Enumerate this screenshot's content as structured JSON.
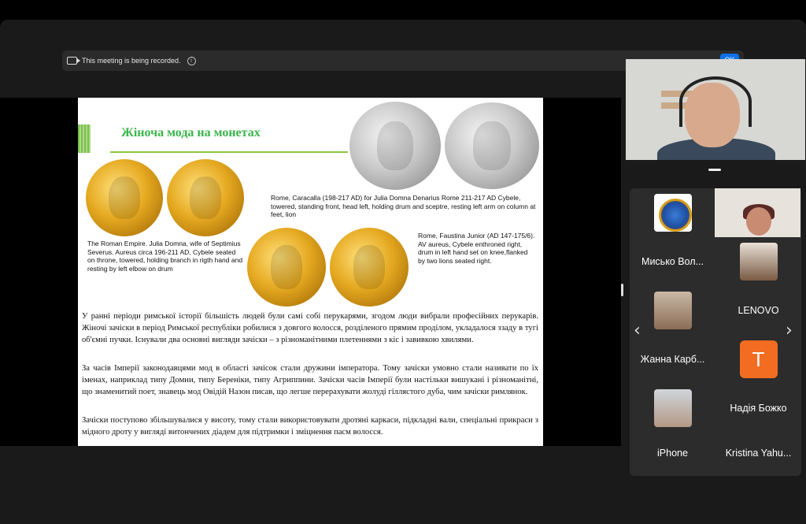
{
  "banner": {
    "text": "This meeting is being recorded.",
    "info": "i",
    "ok_label": "OK"
  },
  "slide": {
    "title": "Жіноча мода на монетах",
    "caption_top_right": "Rome, Caracalla (198-217 AD) for Julia Domna Denarius Rome 211-217 AD Cybele, towered, standing front, head left, holding drum and sceptre, resting left arm on column at feet, lion",
    "caption_left": "The Roman Empire. Julia Domna, wife of Septimius Severus. Aureus circa 196-211 AD, Cybele seated on throne, towered, holding branch in rigth hand and resting by left elbow on drum",
    "caption_right": "Rome, Faustina Junior (AD 147-175/6). AV aureus, Cybele enthroned right, drum in left hand set on knee,flanked by two lions seated right.",
    "paragraphs": [
      "У ранні періоди римської історії більшість людей були самі собі перукарями, згодом люди вибрали професійних перукарів. Жіночі зачіски в період Римської республіки робилися з довгого волосся, розділеного прямим проділом, укладалося ззаду в тугі об'ємні пучки. Існували два основні вигляди зачіски – з різноманітними плетеннями з кіс і завивкою хвилями.",
      "За часів Імперії законодавцями мод в області зачісок стали дружини імператора. Тому зачіски умовно стали називати по їх іменах, наприклад типу Домни, типу Береніки, типу Агриппини. Зачіски часів Імперії були настільки вишукані і різноманітні, що знаменитий поет, знавець мод Овідій Назон писав, що легше перерахувати жолуді гіллястого дуба, чим зачіски римлянок.",
      "Зачіски поступово збільшувалися у висоту, тому стали використовувати дротяні каркаси, підкладні вали, спеціальні прикраси з мідного дроту у вигляді витончених діадем для підтримки і зміцнення пасм волосся."
    ]
  },
  "participants": [
    {
      "name": "Мисько Вол..."
    },
    {
      "name": "LENOVO"
    },
    {
      "name": "Жанна Карб..."
    },
    {
      "name": "Надія Божко",
      "initial": "T"
    },
    {
      "name": "iPhone"
    },
    {
      "name": "Kristina Yahu..."
    }
  ],
  "nav": {
    "prev": "‹",
    "next": "›"
  }
}
